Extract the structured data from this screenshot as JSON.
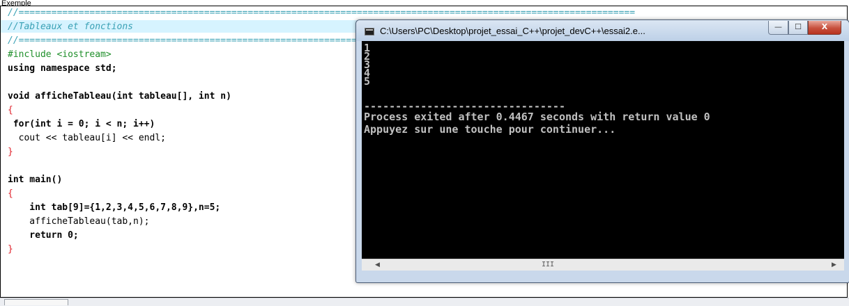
{
  "page": {
    "label": "Exemple"
  },
  "editor": {
    "lines": [
      {
        "text": "//================================================================================================================="
      },
      {
        "text": "//Tableaux et fonctions"
      },
      {
        "text": "//================================================================================================================="
      },
      {
        "text": "#include <iostream>"
      },
      {
        "text": "using namespace std;"
      },
      {
        "text": ""
      },
      {
        "text": "void afficheTableau(int tableau[], int n)"
      },
      {
        "text": "{"
      },
      {
        "text": " for(int i = 0; i < n; i++)"
      },
      {
        "text": "  cout << tableau[i] << endl;"
      },
      {
        "text": "}"
      },
      {
        "text": ""
      },
      {
        "text": "int main()"
      },
      {
        "text": "{"
      },
      {
        "text": "    int tab[9]={1,2,3,4,5,6,7,8,9},n=5;"
      },
      {
        "text": "    afficheTableau(tab,n);"
      },
      {
        "text": "    return 0;"
      },
      {
        "text": "}"
      }
    ]
  },
  "console": {
    "title": "C:\\Users\\PC\\Desktop\\projet_essai_C++\\projet_devC++\\essai2.e...",
    "buttons": {
      "minimize": "—",
      "maximize": "☐",
      "close": "X"
    },
    "output_lines": [
      "1",
      "2",
      "3",
      "4",
      "5"
    ],
    "separator": "--------------------------------",
    "status": "Process exited after 0.4467 seconds with return value 0",
    "prompt": "Appuyez sur une touche pour continuer...",
    "scroll": {
      "left_arrow": "◀",
      "right_arrow": "▶",
      "grip": "III"
    }
  },
  "colors": {
    "comment": "#3aa1b5",
    "preprocessor": "#1f8f2a",
    "symbol": "#e0222b",
    "number": "#b62fb0",
    "highlight_line": "#d6f3ff",
    "console_bg": "#000000",
    "console_text": "#c0c0c0"
  },
  "icons": {
    "console_app": "console-app-icon",
    "close": "close-icon"
  }
}
